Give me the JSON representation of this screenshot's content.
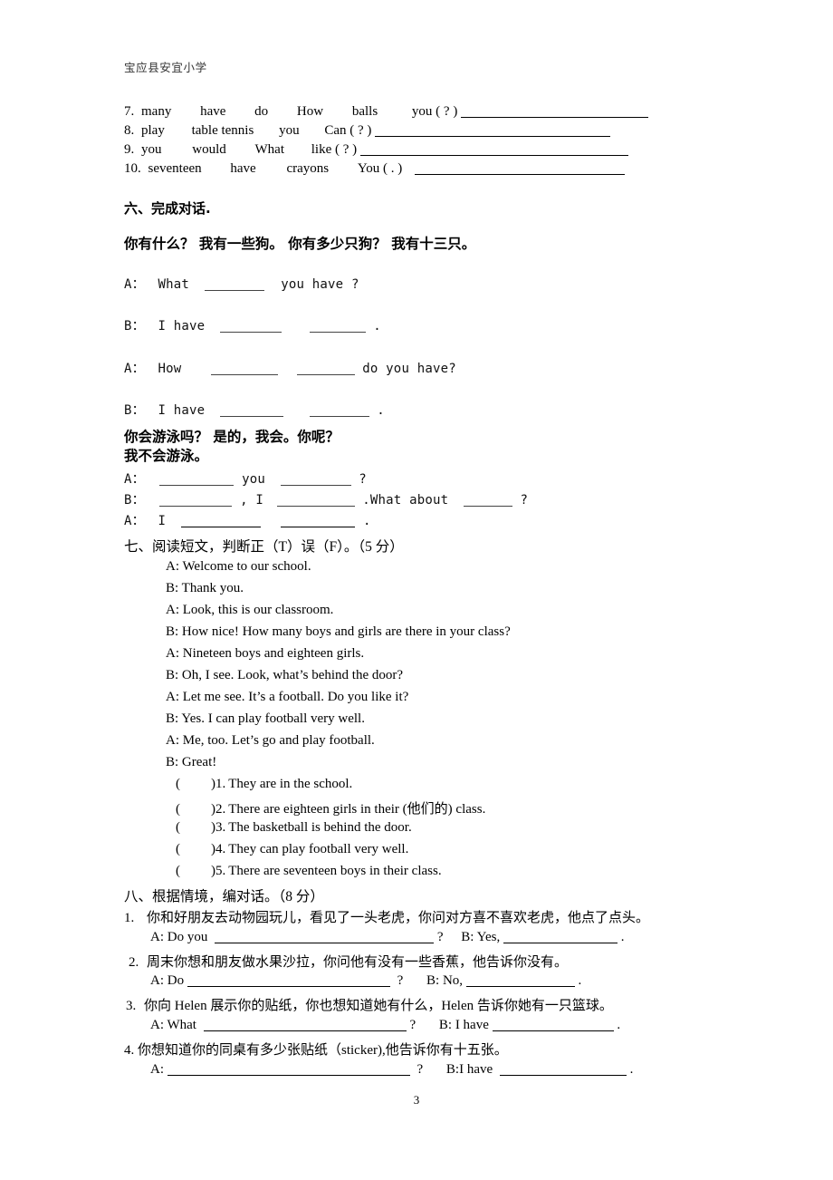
{
  "document": {
    "header": "宝应县安宜小学",
    "page_number": "3"
  },
  "word_order": {
    "items": [
      {
        "num": "7.",
        "words": [
          "many",
          "have",
          "do",
          "How",
          "balls",
          "you ( ? )"
        ],
        "rule_width": 207
      },
      {
        "num": "8.",
        "words": [
          "play",
          "table tennis",
          "you",
          "Can ( ? )"
        ],
        "rule_width": 260
      },
      {
        "num": "9.",
        "words": [
          "you",
          "would",
          "What",
          "like ( ? )"
        ],
        "rule_width": 296
      },
      {
        "num": "10.",
        "words": [
          "seventeen",
          "have",
          "crayons",
          "You ( . )"
        ],
        "rule_width": 232
      }
    ]
  },
  "section_six": {
    "heading": "六、完成对话.",
    "prompt_cn": "你有什么？             我有一些狗。 你有多少只狗？        我有十三只。",
    "lines": [
      {
        "speaker": "A：",
        "seg1": "What",
        "rule1": 66,
        "seg2": "you   have ?",
        "rule2": 0,
        "seg3": ""
      },
      {
        "speaker": "B：",
        "seg1": "I have",
        "rule1": 68,
        "seg2": "",
        "rule2": 62,
        "seg3": "."
      },
      {
        "speaker": "A：",
        "seg1": " How",
        "rule1": 74,
        "seg2": "",
        "rule2": 64,
        "seg3": "do you have?"
      },
      {
        "speaker": "B：",
        "seg1": "I have",
        "rule1": 70,
        "seg2": "",
        "rule2": 66,
        "seg3": "."
      }
    ],
    "prompt_cn2_line1": "你会游泳吗？      是的，我会。你呢？",
    "prompt_cn2_line2": "我不会游泳。",
    "lines2": [
      {
        "speaker": "A：",
        "pre": "",
        "rule1": 82,
        "mid": "you",
        "rule2": 78,
        "post": "?",
        "rule3": 0,
        "tail": ""
      },
      {
        "speaker": "B：",
        "pre": "",
        "rule1": 80,
        "mid": ", I",
        "rule2": 86,
        "post": ".What about",
        "rule3": 54,
        "tail": "?"
      },
      {
        "speaker": "A：",
        "pre": "I",
        "rule1": 88,
        "mid": "",
        "rule2": 82,
        "post": ".",
        "rule3": 0,
        "tail": ""
      }
    ]
  },
  "section_seven": {
    "heading": "七、阅读短文，判断正（T）误（F）。（5 分）",
    "dialogue": [
      "A: Welcome to our school.",
      "B: Thank you.",
      "A: Look, this is our classroom.",
      "B: How nice! How many boys and girls are there in your class?",
      "A: Nineteen boys and eighteen girls.",
      "B: Oh, I see. Look, what’s behind the door?",
      "A: Let me see. It’s a football. Do you like it?",
      "B: Yes. I can play football very well.",
      "A: Me, too. Let’s go and play football.",
      "B: Great!"
    ],
    "judgements": [
      {
        "label": ")1.",
        "text": "They are in the school."
      },
      {
        "label": ")2.",
        "text": "There are eighteen girls in their (他们的) class."
      },
      {
        "label": ")3.",
        "text": "The basketball is behind the door."
      },
      {
        "label": ")4.",
        "text": "They can play football very well."
      },
      {
        "label": ")5.",
        "text": "There are seventeen boys in their class."
      }
    ]
  },
  "section_eight": {
    "heading": "八、根据情境，编对话。（8 分）",
    "items": [
      {
        "num": "1.",
        "situation": "你和好朋友去动物园玩儿，看见了一头老虎，你问对方喜不喜欢老虎，他点了点头。",
        "a_prefix": "A: Do you",
        "a_rule": 242,
        "a_suffix": "?",
        "b_prefix": "B: Yes,",
        "b_rule": 126,
        "b_suffix": "."
      },
      {
        "num": "2.",
        "situation": "周末你想和朋友做水果沙拉，你问他有没有一些香蕉，他告诉你没有。",
        "a_prefix": "A: Do",
        "a_rule": 224,
        "a_suffix": "?",
        "b_prefix": "B: No,",
        "b_rule": 120,
        "b_suffix": "."
      },
      {
        "num": "3.",
        "situation": "你向 Helen 展示你的贴纸，你也想知道她有什么，Helen 告诉你她有一只篮球。",
        "a_prefix": "A: What",
        "a_rule": 224,
        "a_suffix": "?",
        "b_prefix": "B: I have",
        "b_rule": 134,
        "b_suffix": "."
      },
      {
        "num": "4.",
        "situation": "你想知道你的同桌有多少张贴纸（sticker),他告诉你有十五张。",
        "a_prefix": "A:",
        "a_rule": 268,
        "a_suffix": "?",
        "b_prefix": "B:I have",
        "b_rule": 140,
        "b_suffix": "."
      }
    ]
  }
}
